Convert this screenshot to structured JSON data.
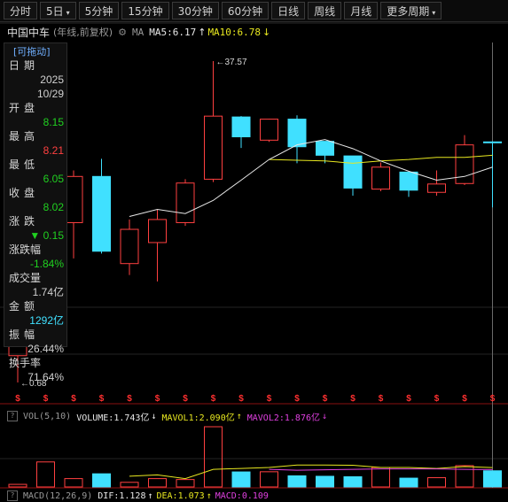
{
  "toolbar": {
    "tabs": [
      "分时",
      "5日",
      "5分钟",
      "15分钟",
      "30分钟",
      "60分钟",
      "日线",
      "周线",
      "月线",
      "更多周期"
    ],
    "dropdown_glyph": "▾"
  },
  "header": {
    "stock_name": "中国中车",
    "mode": "(年线,前复权)",
    "gear_icon": "gear-icon",
    "ma_label": "MA",
    "ma5": "MA5:6.17",
    "ma10": "MA10:6.78",
    "up_arrow": "↑",
    "down_arrow": "↓"
  },
  "info_panel": {
    "drag_label": "[可拖动]",
    "date_label": "日期",
    "date_year": "2025",
    "date_md": "10/29",
    "open_label": "开盘",
    "open": "8.15",
    "high_label": "最高",
    "high": "8.21",
    "low_label": "最低",
    "low": "6.05",
    "close_label": "收盘",
    "close": "8.02",
    "change_label": "涨跌",
    "change": "▼ 0.15",
    "change_pct_label": "涨跌幅",
    "change_pct": "-1.84%",
    "volume_label": "成交量",
    "volume": "1.74亿",
    "amount_label": "金额",
    "amount": "1292亿",
    "amplitude_label": "振幅",
    "amplitude": "26.44%",
    "turnover_label": "换手率",
    "turnover": "71.64%"
  },
  "price_annotations": {
    "high_marker": "37.57",
    "low_marker": "0.68",
    "arrow": "←"
  },
  "volume_panel": {
    "title": "VOL(5,10)",
    "volume": "VOLUME:1.743亿",
    "mavol1": "MAVOL1:2.090亿",
    "mavol2": "MAVOL2:1.876亿",
    "down": "↓",
    "up": "↑",
    "help": "?"
  },
  "macd_panel": {
    "title": "MACD(12,26,9)",
    "dif": "DIF:1.128",
    "dea": "DEA:1.073",
    "macd": "MACD:0.109",
    "help": "?"
  },
  "colors": {
    "up": "#ff4040",
    "down": "#40e0ff",
    "ma5": "#e8e8e8",
    "ma10": "#e8e820",
    "mavol2": "#e040e0"
  },
  "chart_data": {
    "type": "candlestick",
    "candles": [
      {
        "open": 0.95,
        "high": 1.85,
        "low": 0.68,
        "close": 1.35,
        "dir": "up"
      },
      {
        "open": 2.5,
        "high": 3.5,
        "low": 2.2,
        "close": 4.9,
        "dir": "up"
      },
      {
        "open": 5.0,
        "high": 9.6,
        "low": 3.2,
        "close": 8.9,
        "dir": "up"
      },
      {
        "open": 8.9,
        "high": 11.1,
        "low": 3.4,
        "close": 3.5,
        "dir": "down"
      },
      {
        "open": 3.0,
        "high": 5.2,
        "low": 2.6,
        "close": 4.6,
        "dir": "up"
      },
      {
        "open": 3.9,
        "high": 5.9,
        "low": 2.4,
        "close": 5.2,
        "dir": "up"
      },
      {
        "open": 5.0,
        "high": 8.6,
        "low": 4.8,
        "close": 8.2,
        "dir": "up"
      },
      {
        "open": 8.6,
        "high": 37.57,
        "low": 8.3,
        "close": 18.9,
        "dir": "up"
      },
      {
        "open": 18.7,
        "high": 18.9,
        "low": 12.7,
        "close": 14.6,
        "dir": "down"
      },
      {
        "open": 14.0,
        "high": 18.3,
        "low": 13.7,
        "close": 18.2,
        "dir": "up"
      },
      {
        "open": 18.2,
        "high": 19.1,
        "low": 10.5,
        "close": 12.9,
        "dir": "down"
      },
      {
        "open": 13.8,
        "high": 13.8,
        "low": 10.5,
        "close": 11.6,
        "dir": "down"
      },
      {
        "open": 11.5,
        "high": 11.5,
        "low": 7.0,
        "close": 7.7,
        "dir": "down"
      },
      {
        "open": 7.6,
        "high": 10.6,
        "low": 7.4,
        "close": 10.0,
        "dir": "up"
      },
      {
        "open": 9.4,
        "high": 9.4,
        "low": 6.9,
        "close": 7.5,
        "dir": "down"
      },
      {
        "open": 7.3,
        "high": 9.6,
        "low": 7.0,
        "close": 8.1,
        "dir": "up"
      },
      {
        "open": 8.15,
        "high": 14.9,
        "low": 8.0,
        "close": 13.2,
        "dir": "up"
      },
      {
        "open": 13.7,
        "high": 13.8,
        "low": 6.05,
        "close": 13.6,
        "dir": "down"
      }
    ],
    "ma5": [
      null,
      null,
      null,
      null,
      5.4,
      5.9,
      5.6,
      6.6,
      8.5,
      11.0,
      13.2,
      14.1,
      12.6,
      10.8,
      9.5,
      8.5,
      8.9,
      10.0
    ],
    "ma10": [
      null,
      null,
      null,
      null,
      null,
      null,
      null,
      null,
      null,
      11.0,
      10.9,
      10.8,
      10.5,
      10.8,
      11.0,
      11.3,
      11.3,
      11.6
    ],
    "volume": [
      0.28,
      2.7,
      0.9,
      1.42,
      0.5,
      0.9,
      0.8,
      6.5,
      1.62,
      1.64,
      1.2,
      1.15,
      1.1,
      2.1,
      0.95,
      1.0,
      2.3,
      1.743
    ],
    "mavol1": [
      null,
      null,
      null,
      null,
      1.16,
      1.3,
      0.9,
      1.9,
      2.0,
      2.1,
      2.37,
      2.36,
      2.34,
      2.1,
      2.1,
      2.0,
      2.2,
      2.09
    ],
    "mavol2": [
      null,
      null,
      null,
      null,
      null,
      null,
      null,
      null,
      null,
      1.9,
      1.8,
      1.85,
      1.9,
      1.95,
      1.95,
      1.95,
      1.9,
      1.876
    ],
    "y_scale": "log",
    "grid": false
  }
}
